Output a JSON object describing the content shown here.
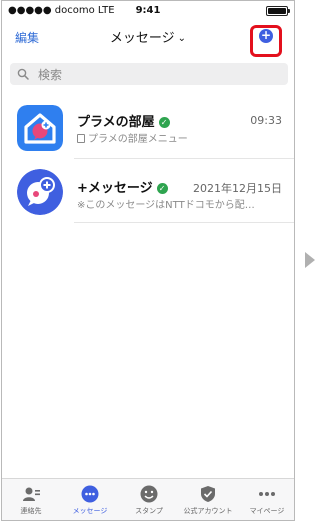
{
  "status_bar": {
    "carrier": "●●●●● docomo  LTE",
    "time": "9:41"
  },
  "nav": {
    "edit": "編集",
    "title": "メッセージ",
    "compose_icon": "plus-circle-icon",
    "highlight_color": "#e3101d"
  },
  "search": {
    "placeholder": "検索"
  },
  "chats": [
    {
      "name": "プラメの部屋",
      "time": "09:33",
      "preview": "プラメの部屋メニュー",
      "avatar_color": "#2f7fef"
    },
    {
      "name": "+メッセージ",
      "time": "2021年12月15日",
      "preview": "※このメッセージはNTTドコモから配…",
      "avatar_color": "#3f5fe0"
    }
  ],
  "tabs": [
    {
      "label": "連絡先",
      "icon": "contacts-icon"
    },
    {
      "label": "メッセージ",
      "icon": "message-icon",
      "active": true
    },
    {
      "label": "スタンプ",
      "icon": "sticker-icon"
    },
    {
      "label": "公式アカウント",
      "icon": "official-account-icon"
    },
    {
      "label": "マイページ",
      "icon": "more-icon"
    }
  ],
  "colors": {
    "accent": "#3f5fe0",
    "verified": "#2ea44f"
  }
}
